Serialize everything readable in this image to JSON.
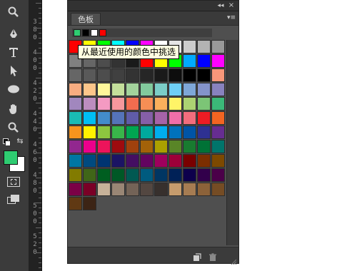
{
  "panel": {
    "tab_label": "色板",
    "collapse_glyph": "◂◂",
    "close_glyph": "×",
    "menu_glyph": "▾≡"
  },
  "tooltip": {
    "text": "从最近使用的颜色中挑选"
  },
  "recent_colors": [
    "#2ecc71",
    "#000000",
    "#ffffff",
    "#ff0000"
  ],
  "colors": {
    "foreground": "#2ecc71",
    "background": "#ffffff",
    "panel_bg": "#4f4f4f",
    "toolbar_bg": "#3b3b3b"
  },
  "tools": [
    {
      "name": "zoom-tool-icon"
    },
    {
      "name": "pen-tool-icon"
    },
    {
      "name": "type-tool-icon"
    },
    {
      "name": "path-selection-tool-icon"
    },
    {
      "name": "ellipse-tool-icon"
    },
    {
      "name": "hand-tool-icon"
    },
    {
      "name": "zoom-tool-bottom-icon"
    }
  ],
  "ruler_labels": [
    "3",
    "8",
    "0",
    "4",
    "0",
    "0",
    "4",
    "2",
    "0",
    "4",
    "4",
    "0",
    "4",
    "6",
    "0",
    "4",
    "8",
    "0",
    "5",
    "0",
    "0",
    "5",
    "2",
    "0"
  ],
  "swatches": [
    [
      "#ff0000",
      "#ffff00",
      "#00ff00",
      "#00ffff",
      "#0000ff",
      "#ff00ff",
      "#ffffff",
      "#e6e6e6",
      "#cccccc",
      "#b3b3b3",
      "#999999"
    ],
    [
      "#808080",
      "#666666",
      "#4d4d4d",
      "#333333",
      "#1a1a1a",
      "#ff0000",
      "#ffff00",
      "#00ff00",
      "#00aaff",
      "#0000ff",
      "#ff00ff"
    ],
    [
      "#666666",
      "#595959",
      "#4d4d4d",
      "#404040",
      "#333333",
      "#262626",
      "#1a1a1a",
      "#0d0d0d",
      "#000000",
      "#000000",
      "#f7977a"
    ],
    [
      "#f9ad81",
      "#fdc68a",
      "#fff79a",
      "#c4df9b",
      "#a3d39c",
      "#82ca9d",
      "#7bcdc8",
      "#6ecff6",
      "#7ea7d8",
      "#8493ca",
      "#8882be"
    ],
    [
      "#a187be",
      "#bc8dbf",
      "#f49ac2",
      "#f6989d",
      "#f26c4f",
      "#f68e55",
      "#fbaf5c",
      "#fff467",
      "#acd372",
      "#7cc576",
      "#3bb878"
    ],
    [
      "#1abbb4",
      "#00bff3",
      "#438ccb",
      "#5574b9",
      "#605ca8",
      "#855fa8",
      "#a763a8",
      "#f06ea9",
      "#f26d7d",
      "#ed1c24",
      "#f26522"
    ],
    [
      "#f7941d",
      "#fff200",
      "#8dc63f",
      "#39b54a",
      "#00a651",
      "#00a99d",
      "#00aeef",
      "#0072bc",
      "#0054a6",
      "#2e3192",
      "#662d91"
    ],
    [
      "#92278f",
      "#ec008c",
      "#ed145b",
      "#9e0b0f",
      "#a0410d",
      "#a36209",
      "#aba000",
      "#598527",
      "#197b30",
      "#007236",
      "#00746b"
    ],
    [
      "#0076a3",
      "#004a80",
      "#003471",
      "#1b1464",
      "#440e62",
      "#630460",
      "#9e005d",
      "#9e0039",
      "#790000",
      "#7b2e00",
      "#7d4900"
    ],
    [
      "#827b00",
      "#406618",
      "#005e20",
      "#005826",
      "#005952",
      "#005b7f",
      "#003663",
      "#002157",
      "#0d004c",
      "#32004b",
      "#4b0049"
    ],
    [
      "#7b0046",
      "#7a0026",
      "#c7b299",
      "#998675",
      "#736357",
      "#534741",
      "#37302d",
      "#c69c6d",
      "#a67c52",
      "#8c6239",
      "#754c24"
    ],
    [
      "#603913",
      "#3c2415"
    ]
  ]
}
